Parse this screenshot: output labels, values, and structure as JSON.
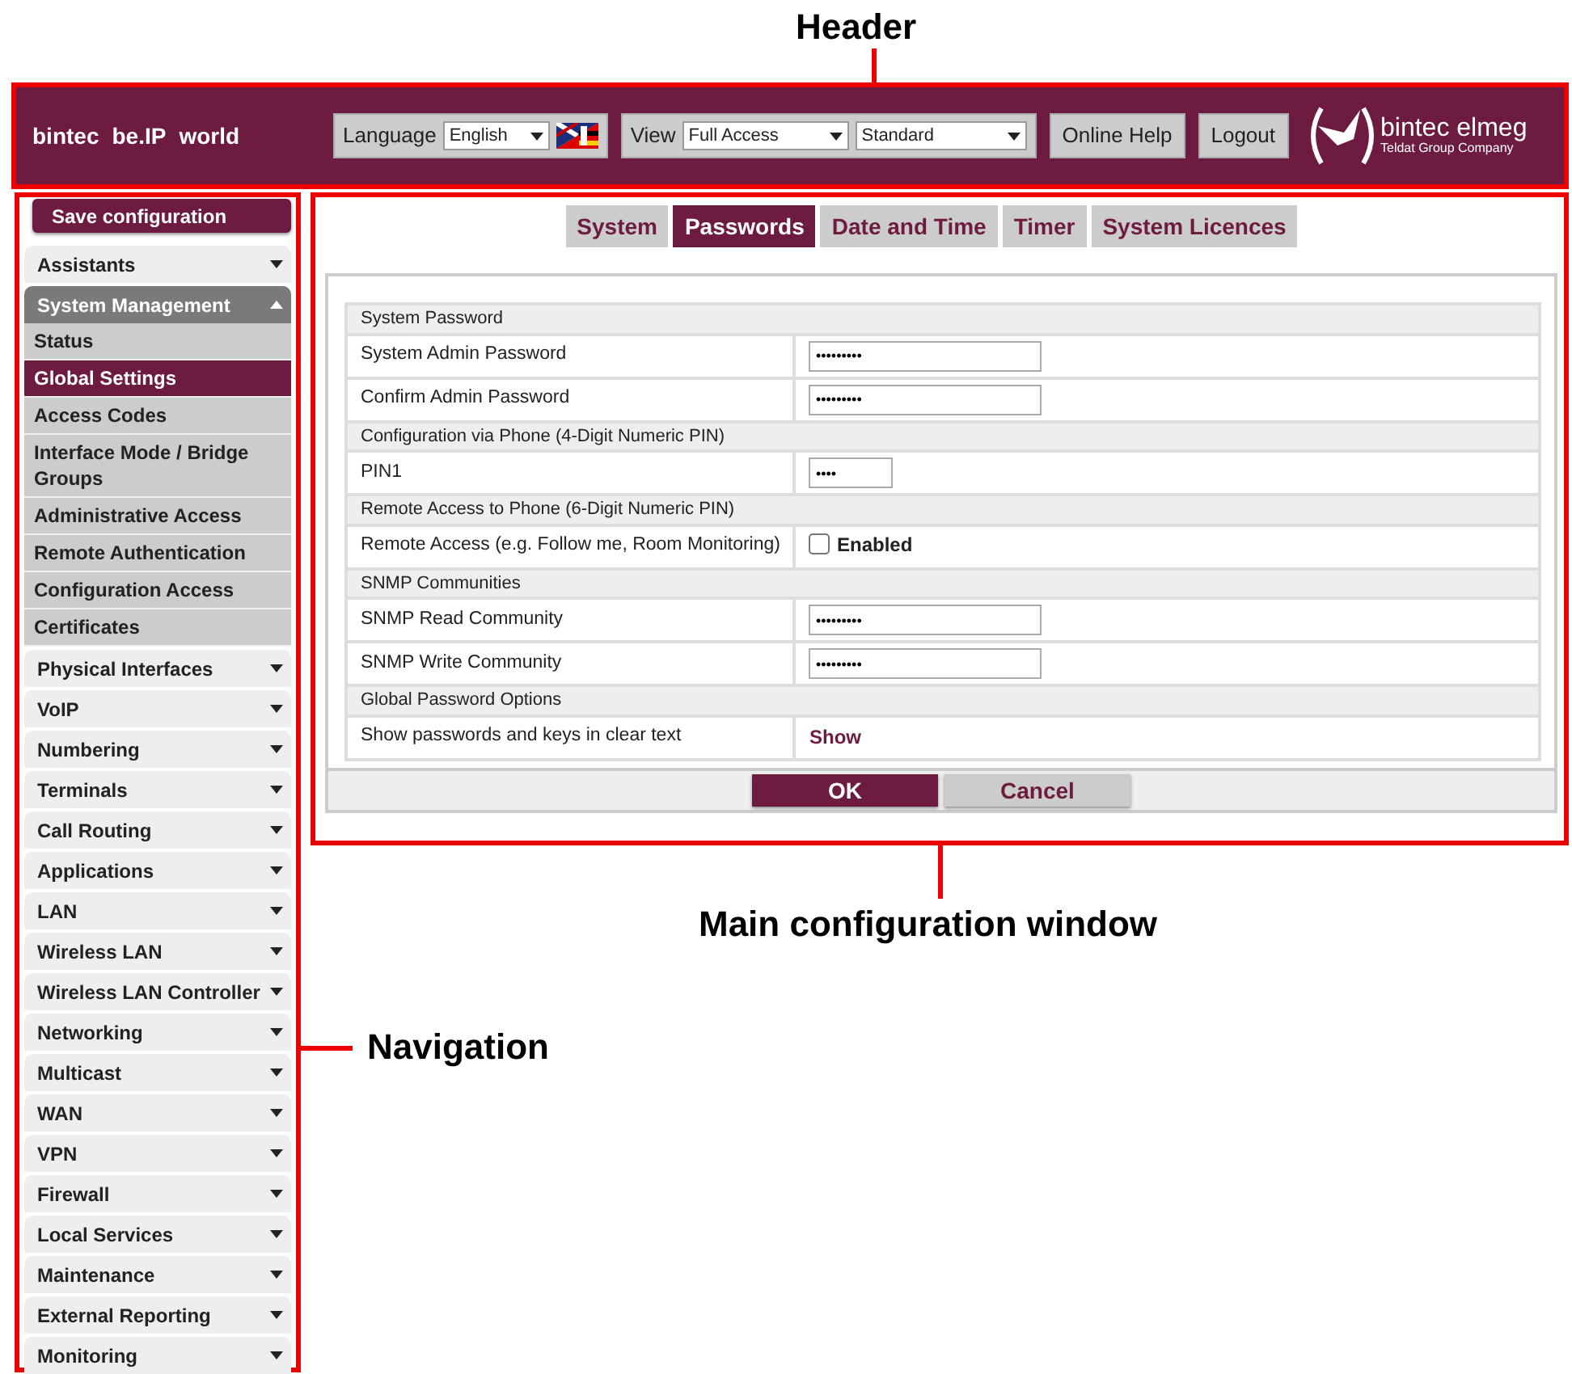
{
  "callouts": {
    "header": "Header",
    "main": "Main configuration window",
    "navigation": "Navigation"
  },
  "header": {
    "brand": [
      "bintec",
      "be.IP",
      "world"
    ],
    "language_label": "Language",
    "language_value": "English",
    "view_label": "View",
    "view_value": "Full Access",
    "mode_value": "Standard",
    "buttons": [
      "Online Help",
      "Logout"
    ],
    "logo_name": "bintec elmeg",
    "logo_tagline": "Teldat Group Company"
  },
  "sidebar": {
    "save_button": "Save configuration",
    "items": [
      {
        "label": "Assistants",
        "expanded": false
      },
      {
        "label": "System Management",
        "expanded": true,
        "children": [
          {
            "label": "Status",
            "selected": false
          },
          {
            "label": "Global Settings",
            "selected": true
          },
          {
            "label": "Access Codes",
            "selected": false
          },
          {
            "label": "Interface Mode / Bridge Groups",
            "selected": false
          },
          {
            "label": "Administrative Access",
            "selected": false
          },
          {
            "label": "Remote Authentication",
            "selected": false
          },
          {
            "label": "Configuration Access",
            "selected": false
          },
          {
            "label": "Certificates",
            "selected": false
          }
        ]
      },
      {
        "label": "Physical Interfaces",
        "expanded": false
      },
      {
        "label": "VoIP",
        "expanded": false
      },
      {
        "label": "Numbering",
        "expanded": false
      },
      {
        "label": "Terminals",
        "expanded": false
      },
      {
        "label": "Call Routing",
        "expanded": false
      },
      {
        "label": "Applications",
        "expanded": false
      },
      {
        "label": "LAN",
        "expanded": false
      },
      {
        "label": "Wireless LAN",
        "expanded": false
      },
      {
        "label": "Wireless LAN Controller",
        "expanded": false
      },
      {
        "label": "Networking",
        "expanded": false
      },
      {
        "label": "Multicast",
        "expanded": false
      },
      {
        "label": "WAN",
        "expanded": false
      },
      {
        "label": "VPN",
        "expanded": false
      },
      {
        "label": "Firewall",
        "expanded": false
      },
      {
        "label": "Local Services",
        "expanded": false
      },
      {
        "label": "Maintenance",
        "expanded": false
      },
      {
        "label": "External Reporting",
        "expanded": false
      },
      {
        "label": "Monitoring",
        "expanded": false
      }
    ]
  },
  "tabs": [
    {
      "label": "System",
      "selected": false
    },
    {
      "label": "Passwords",
      "selected": true
    },
    {
      "label": "Date and Time",
      "selected": false
    },
    {
      "label": "Timer",
      "selected": false
    },
    {
      "label": "System Licences",
      "selected": false
    }
  ],
  "sections": [
    {
      "title": "System Password",
      "rows": [
        {
          "label": "System Admin Password",
          "kind": "password",
          "value": "•••••••••"
        },
        {
          "label": "Confirm Admin Password",
          "kind": "password",
          "value": "•••••••••"
        }
      ]
    },
    {
      "title": "Configuration via Phone (4-Digit Numeric PIN)",
      "rows": [
        {
          "label": "PIN1",
          "kind": "pin",
          "value": "••••"
        }
      ]
    },
    {
      "title": "Remote Access to Phone (6-Digit Numeric PIN)",
      "rows": [
        {
          "label": "Remote Access (e.g. Follow me, Room Monitoring)",
          "kind": "checkbox",
          "value": "Enabled",
          "checked": false
        }
      ]
    },
    {
      "title": "SNMP Communities",
      "rows": [
        {
          "label": "SNMP Read Community",
          "kind": "password",
          "value": "•••••••••"
        },
        {
          "label": "SNMP Write Community",
          "kind": "password",
          "value": "•••••••••"
        }
      ]
    },
    {
      "title": "Global Password Options",
      "rows": [
        {
          "label": "Show passwords and keys in clear text",
          "kind": "link",
          "value": "Show"
        }
      ]
    }
  ],
  "buttons": [
    {
      "label": "OK",
      "kind": "primary"
    },
    {
      "label": "Cancel",
      "kind": "secondary"
    }
  ]
}
